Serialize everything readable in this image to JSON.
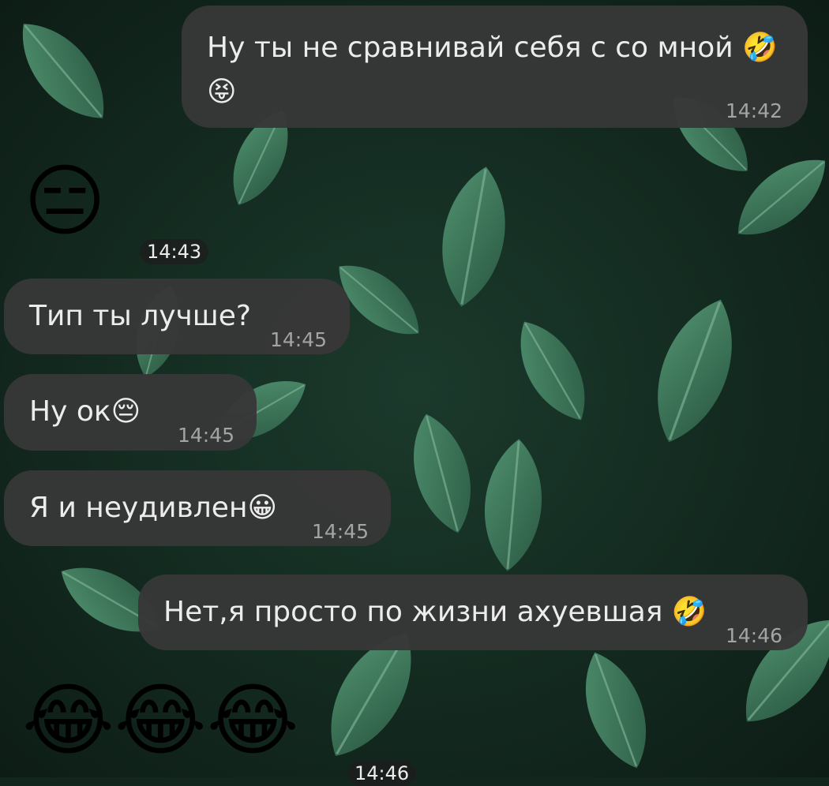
{
  "messages": [
    {
      "id": "m1",
      "direction": "outgoing",
      "text": "Ну ты не сравнивай себя с со мной 🤣",
      "text_line2": "😝",
      "time": "14:42"
    },
    {
      "id": "m2",
      "direction": "incoming",
      "text": "😑",
      "time": "14:43"
    },
    {
      "id": "m3",
      "direction": "incoming",
      "text": "Тип ты лучше?",
      "time": "14:45"
    },
    {
      "id": "m4",
      "direction": "incoming",
      "text": "Ну ок😔",
      "time": "14:45"
    },
    {
      "id": "m5",
      "direction": "incoming",
      "text": "Я и неудивлен😀",
      "time": "14:45"
    },
    {
      "id": "m6",
      "direction": "outgoing",
      "text": "Нет,я просто по жизни ахуевшая 🤣",
      "time": "14:46"
    },
    {
      "id": "m7",
      "direction": "incoming",
      "text": "😂😂😂",
      "time": "14:46"
    }
  ],
  "colors": {
    "bubble": "#373737",
    "text": "#ececec",
    "time": "#a4a4a4",
    "wallpaper_dark": "#12261d",
    "leaf": "#3e7a5c"
  }
}
